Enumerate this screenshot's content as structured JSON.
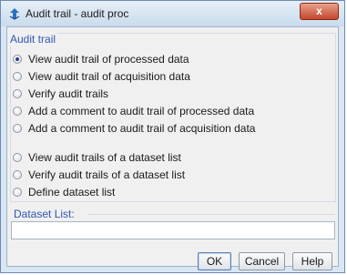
{
  "window": {
    "title": "Audit trail - audit proc",
    "close_label": "x"
  },
  "group": {
    "legend": "Audit trail"
  },
  "options": [
    {
      "label": "View audit trail of processed data",
      "checked": true
    },
    {
      "label": "View audit trail of acquisition data",
      "checked": false
    },
    {
      "label": "Verify audit trails",
      "checked": false
    },
    {
      "label": "Add a comment to audit trail of processed data",
      "checked": false
    },
    {
      "label": "Add a comment to audit trail of acquisition data",
      "checked": false
    },
    {
      "label": "View audit trails of a dataset list",
      "checked": false
    },
    {
      "label": "Verify audit trails of a dataset list",
      "checked": false
    },
    {
      "label": "Define dataset list",
      "checked": false
    }
  ],
  "dataset_list": {
    "label": "Dataset List:",
    "value": ""
  },
  "buttons": {
    "ok": "OK",
    "cancel": "Cancel",
    "help": "Help"
  },
  "colors": {
    "accent_text": "#2f58b4",
    "window_frame": "#d9e6f3",
    "client_bg": "#f0f0f0",
    "close_button": "#c4472c"
  },
  "icons": {
    "app": "app-icon",
    "close": "close-icon"
  }
}
